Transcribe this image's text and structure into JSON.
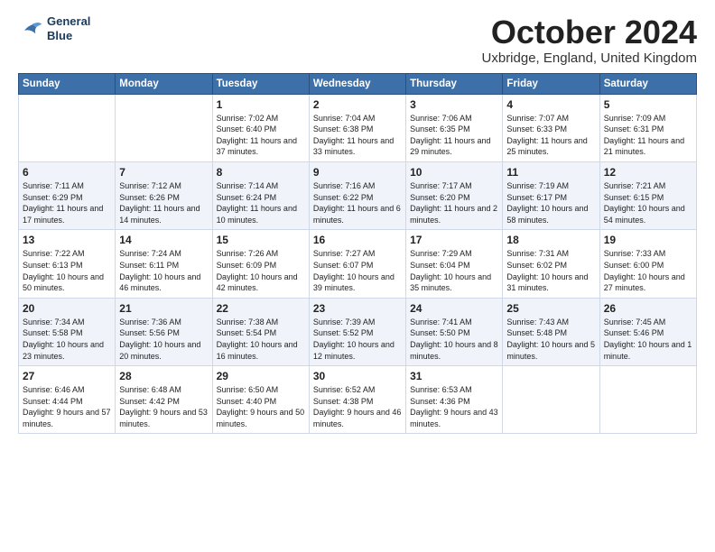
{
  "logo": {
    "line1": "General",
    "line2": "Blue"
  },
  "title": "October 2024",
  "location": "Uxbridge, England, United Kingdom",
  "days_of_week": [
    "Sunday",
    "Monday",
    "Tuesday",
    "Wednesday",
    "Thursday",
    "Friday",
    "Saturday"
  ],
  "weeks": [
    [
      {
        "day": "",
        "content": ""
      },
      {
        "day": "",
        "content": ""
      },
      {
        "day": "1",
        "content": "Sunrise: 7:02 AM\nSunset: 6:40 PM\nDaylight: 11 hours and 37 minutes."
      },
      {
        "day": "2",
        "content": "Sunrise: 7:04 AM\nSunset: 6:38 PM\nDaylight: 11 hours and 33 minutes."
      },
      {
        "day": "3",
        "content": "Sunrise: 7:06 AM\nSunset: 6:35 PM\nDaylight: 11 hours and 29 minutes."
      },
      {
        "day": "4",
        "content": "Sunrise: 7:07 AM\nSunset: 6:33 PM\nDaylight: 11 hours and 25 minutes."
      },
      {
        "day": "5",
        "content": "Sunrise: 7:09 AM\nSunset: 6:31 PM\nDaylight: 11 hours and 21 minutes."
      }
    ],
    [
      {
        "day": "6",
        "content": "Sunrise: 7:11 AM\nSunset: 6:29 PM\nDaylight: 11 hours and 17 minutes."
      },
      {
        "day": "7",
        "content": "Sunrise: 7:12 AM\nSunset: 6:26 PM\nDaylight: 11 hours and 14 minutes."
      },
      {
        "day": "8",
        "content": "Sunrise: 7:14 AM\nSunset: 6:24 PM\nDaylight: 11 hours and 10 minutes."
      },
      {
        "day": "9",
        "content": "Sunrise: 7:16 AM\nSunset: 6:22 PM\nDaylight: 11 hours and 6 minutes."
      },
      {
        "day": "10",
        "content": "Sunrise: 7:17 AM\nSunset: 6:20 PM\nDaylight: 11 hours and 2 minutes."
      },
      {
        "day": "11",
        "content": "Sunrise: 7:19 AM\nSunset: 6:17 PM\nDaylight: 10 hours and 58 minutes."
      },
      {
        "day": "12",
        "content": "Sunrise: 7:21 AM\nSunset: 6:15 PM\nDaylight: 10 hours and 54 minutes."
      }
    ],
    [
      {
        "day": "13",
        "content": "Sunrise: 7:22 AM\nSunset: 6:13 PM\nDaylight: 10 hours and 50 minutes."
      },
      {
        "day": "14",
        "content": "Sunrise: 7:24 AM\nSunset: 6:11 PM\nDaylight: 10 hours and 46 minutes."
      },
      {
        "day": "15",
        "content": "Sunrise: 7:26 AM\nSunset: 6:09 PM\nDaylight: 10 hours and 42 minutes."
      },
      {
        "day": "16",
        "content": "Sunrise: 7:27 AM\nSunset: 6:07 PM\nDaylight: 10 hours and 39 minutes."
      },
      {
        "day": "17",
        "content": "Sunrise: 7:29 AM\nSunset: 6:04 PM\nDaylight: 10 hours and 35 minutes."
      },
      {
        "day": "18",
        "content": "Sunrise: 7:31 AM\nSunset: 6:02 PM\nDaylight: 10 hours and 31 minutes."
      },
      {
        "day": "19",
        "content": "Sunrise: 7:33 AM\nSunset: 6:00 PM\nDaylight: 10 hours and 27 minutes."
      }
    ],
    [
      {
        "day": "20",
        "content": "Sunrise: 7:34 AM\nSunset: 5:58 PM\nDaylight: 10 hours and 23 minutes."
      },
      {
        "day": "21",
        "content": "Sunrise: 7:36 AM\nSunset: 5:56 PM\nDaylight: 10 hours and 20 minutes."
      },
      {
        "day": "22",
        "content": "Sunrise: 7:38 AM\nSunset: 5:54 PM\nDaylight: 10 hours and 16 minutes."
      },
      {
        "day": "23",
        "content": "Sunrise: 7:39 AM\nSunset: 5:52 PM\nDaylight: 10 hours and 12 minutes."
      },
      {
        "day": "24",
        "content": "Sunrise: 7:41 AM\nSunset: 5:50 PM\nDaylight: 10 hours and 8 minutes."
      },
      {
        "day": "25",
        "content": "Sunrise: 7:43 AM\nSunset: 5:48 PM\nDaylight: 10 hours and 5 minutes."
      },
      {
        "day": "26",
        "content": "Sunrise: 7:45 AM\nSunset: 5:46 PM\nDaylight: 10 hours and 1 minute."
      }
    ],
    [
      {
        "day": "27",
        "content": "Sunrise: 6:46 AM\nSunset: 4:44 PM\nDaylight: 9 hours and 57 minutes."
      },
      {
        "day": "28",
        "content": "Sunrise: 6:48 AM\nSunset: 4:42 PM\nDaylight: 9 hours and 53 minutes."
      },
      {
        "day": "29",
        "content": "Sunrise: 6:50 AM\nSunset: 4:40 PM\nDaylight: 9 hours and 50 minutes."
      },
      {
        "day": "30",
        "content": "Sunrise: 6:52 AM\nSunset: 4:38 PM\nDaylight: 9 hours and 46 minutes."
      },
      {
        "day": "31",
        "content": "Sunrise: 6:53 AM\nSunset: 4:36 PM\nDaylight: 9 hours and 43 minutes."
      },
      {
        "day": "",
        "content": ""
      },
      {
        "day": "",
        "content": ""
      }
    ]
  ]
}
